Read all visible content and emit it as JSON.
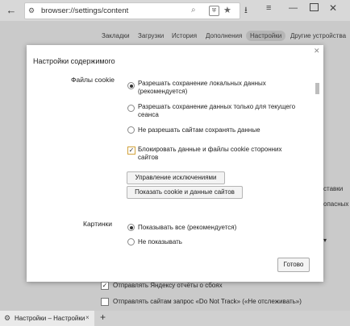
{
  "address_bar": {
    "url": "browser://settings/content"
  },
  "nav": {
    "items": [
      "Закладки",
      "Загрузки",
      "История",
      "Дополнения",
      "Настройки",
      "Другие устройства"
    ],
    "active_index": 4
  },
  "page_fragments": {
    "frag1": "ставки",
    "frag2": "опасных"
  },
  "dialog": {
    "title": "Настройки содержимого",
    "cookies": {
      "label": "Файлы cookie",
      "options": [
        {
          "text": "Разрешать сохранение локальных данных (рекомендуется)",
          "selected": true
        },
        {
          "text": "Разрешать сохранение данных только для текущего сеанса",
          "selected": false
        },
        {
          "text": "Не разрешать сайтам сохранять данные",
          "selected": false
        }
      ],
      "block_third_party": {
        "text": "Блокировать данные и файлы cookie сторонних сайтов",
        "checked": true
      },
      "buttons": {
        "exceptions": "Управление исключениями",
        "show_cookies": "Показать cookie и данные сайтов"
      }
    },
    "images": {
      "label": "Картинки",
      "options": [
        {
          "text": "Показывать все (рекомендуется)",
          "selected": true
        },
        {
          "text": "Не показывать",
          "selected": false
        }
      ]
    },
    "done_button": "Готово"
  },
  "bottom_settings": [
    {
      "text": "Отправлять Яндексу отчёты о сбоях",
      "checked": true
    },
    {
      "text": "Отправлять сайтам запрос «Do Not Track» («Не отслеживать»)",
      "checked": false
    }
  ],
  "tab": {
    "title": "Настройки – Настройки",
    "close": "×"
  },
  "icons": {
    "back": "←",
    "search": "⌕",
    "star": "★",
    "download": "⭳",
    "menu": "≡",
    "minimize": "—",
    "close": "✕",
    "gear": "⚙",
    "plus": "+",
    "dialog_close": "✕"
  }
}
